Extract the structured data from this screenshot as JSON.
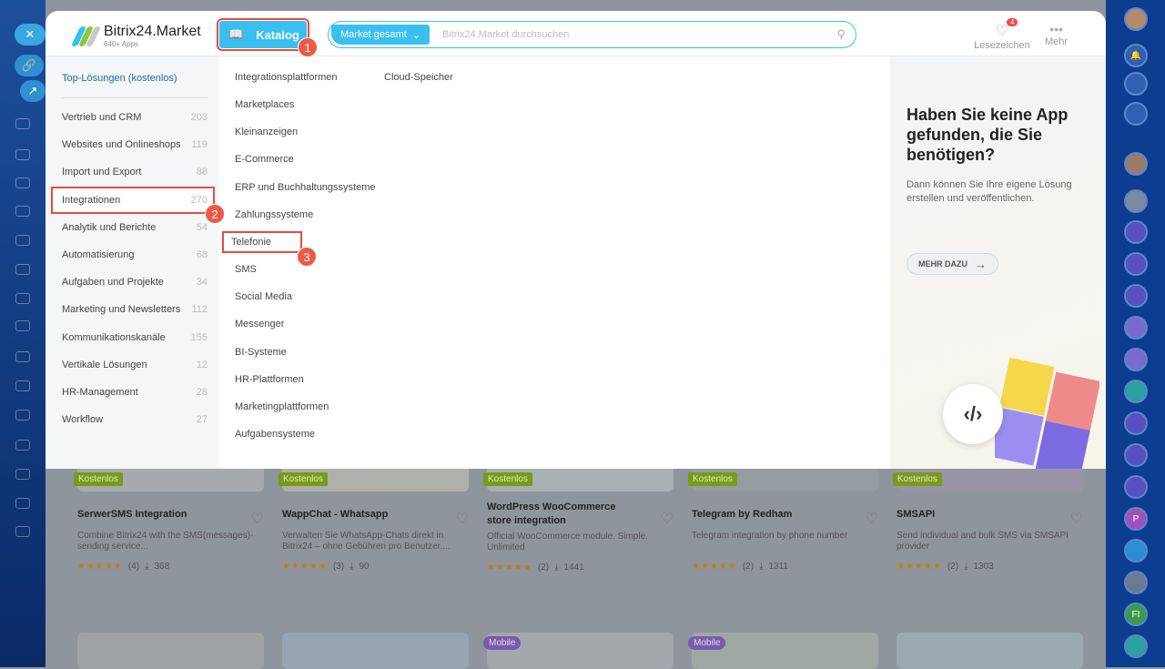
{
  "header": {
    "app_name": "Bitrix24.Market",
    "app_sub": "640+ Apps",
    "catalog_label": "Katalog",
    "search_scope": "Market gesamt",
    "search_placeholder": "Bitrix24.Market durchsuchen",
    "bookmarks_label": "Lesezeichen",
    "bookmarks_count": "4",
    "more_label": "Mehr"
  },
  "annotations": [
    "1",
    "2",
    "3"
  ],
  "categories": {
    "top": "Top-Lösungen (kostenlos)",
    "items": [
      {
        "label": "Vertrieb und CRM",
        "count": "203"
      },
      {
        "label": "Websites und Onlineshops",
        "count": "119"
      },
      {
        "label": "Import und Export",
        "count": "88"
      },
      {
        "label": "Integrationen",
        "count": "270"
      },
      {
        "label": "Analytik und Berichte",
        "count": "54"
      },
      {
        "label": "Automatisierung",
        "count": "68"
      },
      {
        "label": "Aufgaben und Projekte",
        "count": "34"
      },
      {
        "label": "Marketing und Newsletters",
        "count": "112"
      },
      {
        "label": "Kommunikationskanäle",
        "count": "155"
      },
      {
        "label": "Vertikale Lösungen",
        "count": "12"
      },
      {
        "label": "HR-Management",
        "count": "28"
      },
      {
        "label": "Workflow",
        "count": "27"
      }
    ]
  },
  "subcategories": [
    "Integrationsplattformen",
    "Marketplaces",
    "Kleinanzeigen",
    "E-Commerce",
    "ERP und Buchhaltungssysteme",
    "Zahlungssysteme",
    "Telefonie",
    "SMS",
    "Social Media",
    "Messenger",
    "BI-Systeme",
    "HR-Plattformen",
    "Marketingplattformen",
    "Aufgabensysteme",
    "Cloud-Speicher"
  ],
  "promo": {
    "title": "Haben Sie keine App gefunden, die Sie benötigen?",
    "text": "Dann können Sie Ihre eigene Lösung erstellen und veröffentlichen.",
    "button": "MEHR DAZU"
  },
  "apps": [
    {
      "badge": "Kostenlos",
      "title": "SerwerSMS Integration",
      "desc": "Combine Bitrix24 with the SMS(messages)-sending service...",
      "reviews": "(4)",
      "installs": "368"
    },
    {
      "badge": "Kostenlos",
      "title": "WappChat - Whatsapp",
      "desc": "Verwalten Sie WhatsApp-Chats direkt in Bitrix24 – ohne Gebühren pro Benutzer....",
      "reviews": "(3)",
      "installs": "90"
    },
    {
      "badge": "Kostenlos",
      "title": "WordPress WooCommerce store integration",
      "desc": "Official WooCommerce module. Simple. Unlimited",
      "reviews": "(2)",
      "installs": "1441"
    },
    {
      "badge": "Kostenlos",
      "title": "Telegram by Redham",
      "desc": "Telegram integration by phone number",
      "reviews": "(2)",
      "installs": "1311"
    },
    {
      "badge": "Kostenlos",
      "title": "SMSAPI",
      "desc": "Send individual and bulk SMS via SMSAPI provider",
      "reviews": "(2)",
      "installs": "1303"
    }
  ],
  "apps_row2_badges": [
    "Mobile",
    "Mobile"
  ],
  "rating_stars": "★★★★★",
  "right_avatars": [
    "P",
    "FI"
  ],
  "left_pill_close": "✕"
}
